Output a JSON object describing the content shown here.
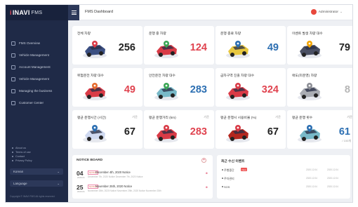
{
  "brand": {
    "mark": "i",
    "name": "INAVI",
    "suffix": "FMS"
  },
  "header": {
    "title": "FMS Dashboard",
    "user": "Administrator"
  },
  "sidebar": {
    "items": [
      {
        "label": "FMS Overview"
      },
      {
        "label": "Vehicle Management"
      },
      {
        "label": "Account Management"
      },
      {
        "label": "Vehicle Management"
      },
      {
        "label": "Managing the business"
      },
      {
        "label": "Customer Center"
      }
    ],
    "links": [
      "About us",
      "Terms of use",
      "Contact",
      "Privacy Policy"
    ],
    "select1": "Korean",
    "select2": "Language",
    "copyright": "Copyright © INAVI FMS All rights reserved."
  },
  "cards": [
    {
      "title": "전체 차량",
      "value": "256",
      "color": "#222222"
    },
    {
      "title": "운행 중 차량",
      "value": "124",
      "color": "#e0434f"
    },
    {
      "title": "운행 종료 차량",
      "value": "49",
      "color": "#2c6fb2"
    },
    {
      "title": "이벤트 발생 차량 대수",
      "value": "79",
      "color": "#222222"
    },
    {
      "title": "위험운전 차량 대수",
      "value": "49",
      "color": "#e0434f"
    },
    {
      "title": "안전운전 차량 대수",
      "value": "283",
      "color": "#2c6fb2"
    },
    {
      "title": "급차구역 진출 차량 대수",
      "value": "324",
      "color": "#e0434f"
    },
    {
      "title": "애도(미운영) 차량",
      "value": "8",
      "color": "#b5b5b5"
    },
    {
      "title": "평균 운행시간 (시간)",
      "unit": "기준",
      "value": "67",
      "color": "#222222"
    },
    {
      "title": "평균 운행거리 (km)",
      "unit": "기준",
      "value": "283",
      "color": "#e0434f"
    },
    {
      "title": "평균 운행시 시용비율 (%)",
      "unit": "기준",
      "value": "67",
      "color": "#222222"
    },
    {
      "title": "평균 운행 횟수",
      "unit": "기준",
      "value": "61",
      "sub": "/ 100개",
      "color": "#2c6fb2"
    }
  ],
  "notice": {
    "title": "NOTICE BOARD",
    "items": [
      {
        "day": "04",
        "month": "2020.01",
        "tag": "NOTICE",
        "title": "December 4th, 2020 Notice",
        "sub": "December 7th, 2020 Notice December 7th, 2020 Notice"
      },
      {
        "day": "25",
        "month": "2020.01",
        "tag": "NOTICE",
        "title": "November 25th, 2020 Notice",
        "sub": "November 25th, 2020 Notice November 25th, 2020 Notice November 25th"
      }
    ]
  },
  "events": {
    "title": "최근 수신 이벤트",
    "items": [
      {
        "name": "주행중단",
        "tag": "New",
        "date1": "2020.12.04",
        "date2": "2020.12.04"
      },
      {
        "name": "주차관리",
        "tag": "",
        "date1": "2020.12.04",
        "date2": "2020.12.04"
      },
      {
        "name": "SOS",
        "tag": "",
        "date1": "2020.12.04",
        "date2": "2020.12.04"
      }
    ]
  },
  "icons": [
    "menu-icon",
    "user-icon",
    "car-icon",
    "plus-icon"
  ]
}
